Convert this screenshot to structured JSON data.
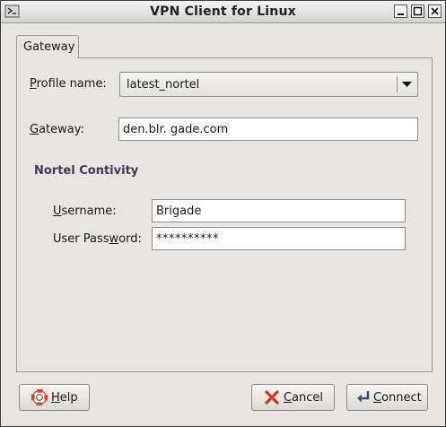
{
  "window": {
    "title": "VPN Client for Linux"
  },
  "tabs": [
    {
      "label": "Gateway"
    }
  ],
  "form": {
    "profile_label_u": "P",
    "profile_label_rest": "rofile name:",
    "profile_value": "latest_nortel",
    "gateway_label_u": "G",
    "gateway_label_rest": "ateway:",
    "gateway_value": "den.blr. gade.com",
    "section_title": "Nortel Contivity",
    "username_label_u": "U",
    "username_label_rest": "sername:",
    "username_value": "Brigade",
    "password_label_pre": "User Pass",
    "password_label_u": "w",
    "password_label_post": "ord:",
    "password_value": "**********"
  },
  "buttons": {
    "help_u": "H",
    "help_rest": "elp",
    "cancel_u": "C",
    "cancel_rest": "ancel",
    "connect_u": "C",
    "connect_rest": "onnect"
  },
  "icons": {
    "app": "app-icon",
    "minimize": "minimize-icon",
    "maximize": "maximize-icon",
    "close": "close-icon",
    "dropdown": "triangle-down-icon",
    "help": "lifebuoy-icon",
    "cancel": "x-icon",
    "connect": "enter-arrow-icon"
  }
}
